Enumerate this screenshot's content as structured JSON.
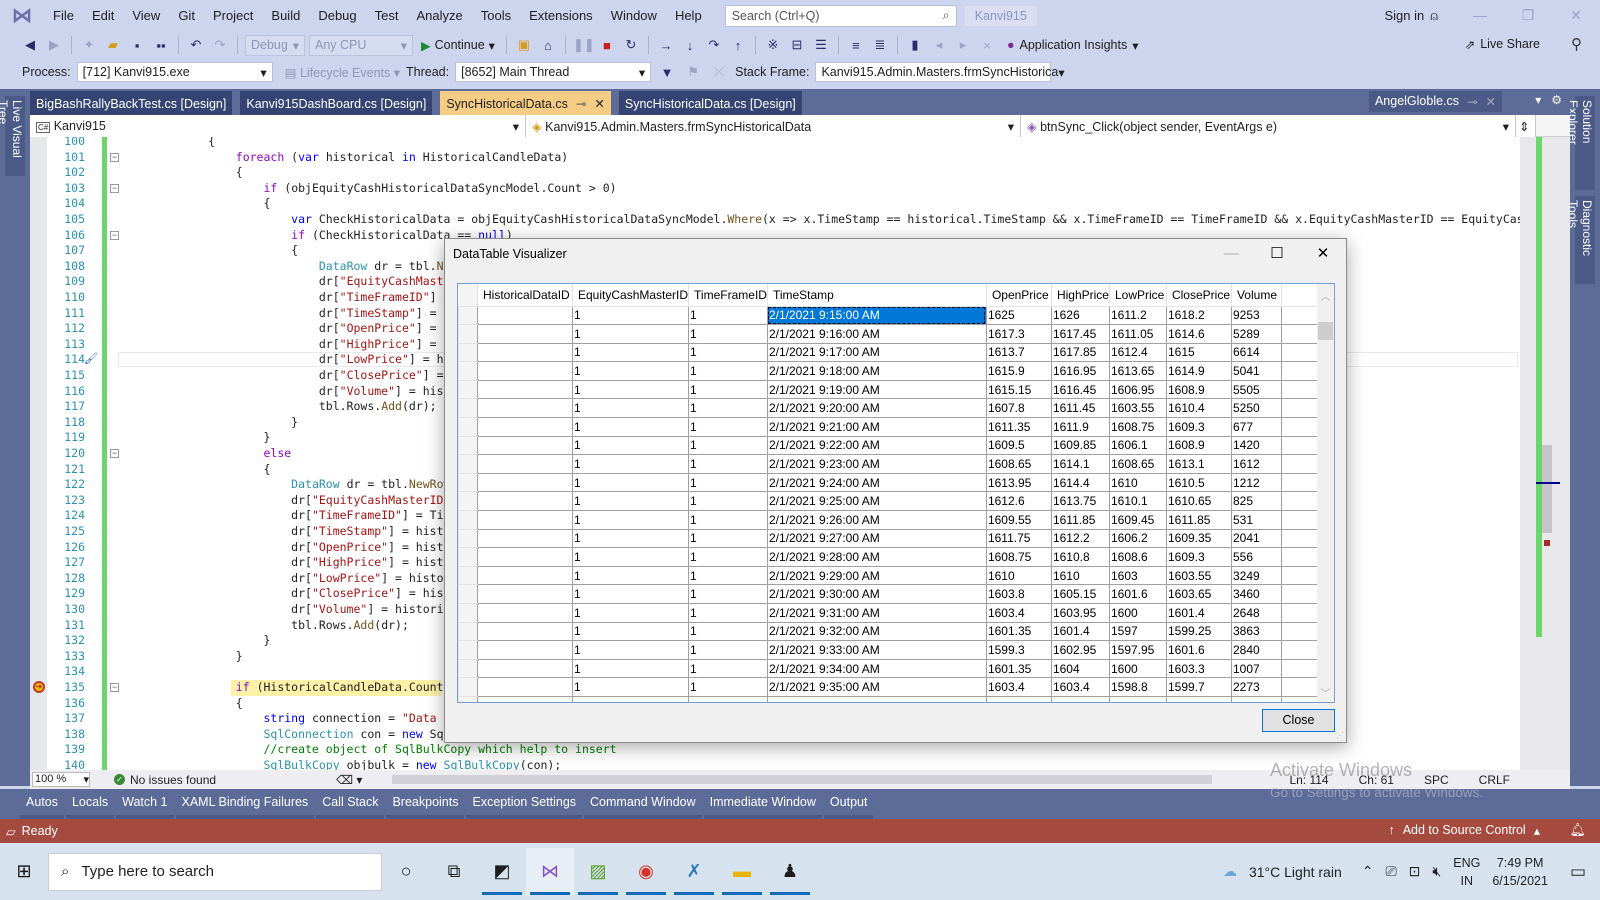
{
  "menubar": {
    "items": [
      "File",
      "Edit",
      "View",
      "Git",
      "Project",
      "Build",
      "Debug",
      "Test",
      "Analyze",
      "Tools",
      "Extensions",
      "Window",
      "Help"
    ],
    "search_placeholder": "Search (Ctrl+Q)",
    "solution_name": "Kanvi915",
    "sign_in": "Sign in"
  },
  "toolbar": {
    "config": "Debug",
    "platform": "Any CPU",
    "continue_label": "Continue",
    "app_insights": "Application Insights",
    "live_share": "Live Share"
  },
  "debugbar": {
    "process_label": "Process:",
    "process_value": "[712] Kanvi915.exe",
    "lifecycle_label": "Lifecycle Events",
    "thread_label": "Thread:",
    "thread_value": "[8652] Main Thread",
    "stack_frame_label": "Stack Frame:",
    "stack_frame_value": "Kanvi915.Admin.Masters.frmSyncHistorica"
  },
  "side_tabs": {
    "left": "Live Visual Tree",
    "right": [
      "Solution Explorer",
      "Diagnostic Tools"
    ]
  },
  "doc_tabs": [
    {
      "label": "BigBashRallyBackTest.cs [Design]",
      "active": false
    },
    {
      "label": "Kanvi915DashBoard.cs [Design]",
      "active": false
    },
    {
      "label": "SyncHistoricalData.cs",
      "active": true
    },
    {
      "label": "SyncHistoricalData.cs [Design]",
      "active": false
    }
  ],
  "preview_tab": "AngelGloble.cs",
  "navbar": {
    "project": "Kanvi915",
    "class": "Kanvi915.Admin.Masters.frmSyncHistoricalData",
    "member": "btnSync_Click(object sender, EventArgs e)"
  },
  "code_lines": [
    {
      "n": "100",
      "t": "            {"
    },
    {
      "n": "101",
      "t": "                foreach (var historical in HistoricalCandleData)"
    },
    {
      "n": "102",
      "t": "                {"
    },
    {
      "n": "103",
      "t": "                    if (objEquityCashHistoricalDataSyncModel.Count > 0)"
    },
    {
      "n": "104",
      "t": "                    {"
    },
    {
      "n": "105",
      "t": "                        var CheckHistoricalData = objEquityCashHistoricalDataSyncModel.Where(x => x.TimeStamp == historical.TimeStamp && x.TimeFrameID == TimeFrameID && x.EquityCashMasterID == EquityCashM"
    },
    {
      "n": "106",
      "t": "                        if (CheckHistoricalData == null)"
    },
    {
      "n": "107",
      "t": "                        {"
    },
    {
      "n": "108",
      "t": "                            DataRow dr = tbl.NewRow();"
    },
    {
      "n": "109",
      "t": "                            dr[\"EquityCashMasterID\"] ="
    },
    {
      "n": "110",
      "t": "                            dr[\"TimeFrameID\"] ="
    },
    {
      "n": "111",
      "t": "                            dr[\"TimeStamp\"] = h"
    },
    {
      "n": "112",
      "t": "                            dr[\"OpenPrice\"] = h"
    },
    {
      "n": "113",
      "t": "                            dr[\"HighPrice\"] = h"
    },
    {
      "n": "114",
      "t": "                            dr[\"LowPrice\"] = hi"
    },
    {
      "n": "115",
      "t": "                            dr[\"ClosePrice\"] ="
    },
    {
      "n": "116",
      "t": "                            dr[\"Volume\"] = hist"
    },
    {
      "n": "117",
      "t": "                            tbl.Rows.Add(dr);"
    },
    {
      "n": "118",
      "t": "                        }"
    },
    {
      "n": "119",
      "t": "                    }"
    },
    {
      "n": "120",
      "t": "                    else"
    },
    {
      "n": "121",
      "t": "                    {"
    },
    {
      "n": "122",
      "t": "                        DataRow dr = tbl.NewRow"
    },
    {
      "n": "123",
      "t": "                        dr[\"EquityCashMasterID\""
    },
    {
      "n": "124",
      "t": "                        dr[\"TimeFrameID\"] = Tim"
    },
    {
      "n": "125",
      "t": "                        dr[\"TimeStamp\"] = histo"
    },
    {
      "n": "126",
      "t": "                        dr[\"OpenPrice\"] = histo"
    },
    {
      "n": "127",
      "t": "                        dr[\"HighPrice\"] = histo"
    },
    {
      "n": "128",
      "t": "                        dr[\"LowPrice\"] = histor"
    },
    {
      "n": "129",
      "t": "                        dr[\"ClosePrice\"] = hist"
    },
    {
      "n": "130",
      "t": "                        dr[\"Volume\"] = historic"
    },
    {
      "n": "131",
      "t": "                        tbl.Rows.Add(dr);"
    },
    {
      "n": "132",
      "t": "                    }"
    },
    {
      "n": "133",
      "t": "                }"
    },
    {
      "n": "134",
      "t": ""
    },
    {
      "n": "135",
      "t": "                if (HistoricalCandleData.Count"
    },
    {
      "n": "136",
      "t": "                {"
    },
    {
      "n": "137",
      "t": "                    string connection = \"Data S"
    },
    {
      "n": "138",
      "t": "                    SqlConnection con = new Sql"
    },
    {
      "n": "139",
      "t": "                    //create object of SqlBulkCopy which help to insert"
    },
    {
      "n": "140",
      "t": "                    SqlBulkCopy objbulk = new SqlBulkCopy(con);"
    }
  ],
  "editor_status": {
    "zoom": "100 %",
    "issues": "No issues found",
    "line": "Ln: 114",
    "char": "Ch: 61",
    "spacing": "SPC",
    "eol": "CRLF"
  },
  "tool_tabs": [
    "Autos",
    "Locals",
    "Watch 1",
    "XAML Binding Failures",
    "Call Stack",
    "Breakpoints",
    "Exception Settings",
    "Command Window",
    "Immediate Window",
    "Output"
  ],
  "watermark": {
    "title": "Activate Windows",
    "subtitle": "Go to Settings to activate Windows."
  },
  "statusbar": {
    "ready": "Ready",
    "source_control": "Add to Source Control"
  },
  "taskbar": {
    "search_placeholder": "Type here to search",
    "weather": "31°C  Light rain",
    "lang_top": "ENG",
    "lang_bottom": "IN",
    "time": "7:49 PM",
    "date": "6/15/2021"
  },
  "dialog": {
    "title": "DataTable Visualizer",
    "close_label": "Close",
    "columns": [
      "HistoricalDataID",
      "EquityCashMasterID",
      "TimeFrameID",
      "TimeStamp",
      "OpenPrice",
      "HighPrice",
      "LowPrice",
      "ClosePrice",
      "Volume"
    ],
    "rows": [
      [
        "",
        "1",
        "1",
        "2/1/2021 9:15:00 AM",
        "1625",
        "1626",
        "1611.2",
        "1618.2",
        "9253"
      ],
      [
        "",
        "1",
        "1",
        "2/1/2021 9:16:00 AM",
        "1617.3",
        "1617.45",
        "1611.05",
        "1614.6",
        "5289"
      ],
      [
        "",
        "1",
        "1",
        "2/1/2021 9:17:00 AM",
        "1613.7",
        "1617.85",
        "1612.4",
        "1615",
        "6614"
      ],
      [
        "",
        "1",
        "1",
        "2/1/2021 9:18:00 AM",
        "1615.9",
        "1616.95",
        "1613.65",
        "1614.9",
        "5041"
      ],
      [
        "",
        "1",
        "1",
        "2/1/2021 9:19:00 AM",
        "1615.15",
        "1616.45",
        "1606.95",
        "1608.9",
        "5505"
      ],
      [
        "",
        "1",
        "1",
        "2/1/2021 9:20:00 AM",
        "1607.8",
        "1611.45",
        "1603.55",
        "1610.4",
        "5250"
      ],
      [
        "",
        "1",
        "1",
        "2/1/2021 9:21:00 AM",
        "1611.35",
        "1611.9",
        "1608.75",
        "1609.3",
        "677"
      ],
      [
        "",
        "1",
        "1",
        "2/1/2021 9:22:00 AM",
        "1609.5",
        "1609.85",
        "1606.1",
        "1608.9",
        "1420"
      ],
      [
        "",
        "1",
        "1",
        "2/1/2021 9:23:00 AM",
        "1608.65",
        "1614.1",
        "1608.65",
        "1613.1",
        "1612"
      ],
      [
        "",
        "1",
        "1",
        "2/1/2021 9:24:00 AM",
        "1613.95",
        "1614.4",
        "1610",
        "1610.5",
        "1212"
      ],
      [
        "",
        "1",
        "1",
        "2/1/2021 9:25:00 AM",
        "1612.6",
        "1613.75",
        "1610.1",
        "1610.65",
        "825"
      ],
      [
        "",
        "1",
        "1",
        "2/1/2021 9:26:00 AM",
        "1609.55",
        "1611.85",
        "1609.45",
        "1611.85",
        "531"
      ],
      [
        "",
        "1",
        "1",
        "2/1/2021 9:27:00 AM",
        "1611.75",
        "1612.2",
        "1606.2",
        "1609.35",
        "2041"
      ],
      [
        "",
        "1",
        "1",
        "2/1/2021 9:28:00 AM",
        "1608.75",
        "1610.8",
        "1608.6",
        "1609.3",
        "556"
      ],
      [
        "",
        "1",
        "1",
        "2/1/2021 9:29:00 AM",
        "1610",
        "1610",
        "1603",
        "1603.55",
        "3249"
      ],
      [
        "",
        "1",
        "1",
        "2/1/2021 9:30:00 AM",
        "1603.8",
        "1605.15",
        "1601.6",
        "1603.65",
        "3460"
      ],
      [
        "",
        "1",
        "1",
        "2/1/2021 9:31:00 AM",
        "1603.4",
        "1603.95",
        "1600",
        "1601.4",
        "2648"
      ],
      [
        "",
        "1",
        "1",
        "2/1/2021 9:32:00 AM",
        "1601.35",
        "1601.4",
        "1597",
        "1599.25",
        "3863"
      ],
      [
        "",
        "1",
        "1",
        "2/1/2021 9:33:00 AM",
        "1599.3",
        "1602.95",
        "1597.95",
        "1601.6",
        "2840"
      ],
      [
        "",
        "1",
        "1",
        "2/1/2021 9:34:00 AM",
        "1601.35",
        "1604",
        "1600",
        "1603.3",
        "1007"
      ],
      [
        "",
        "1",
        "1",
        "2/1/2021 9:35:00 AM",
        "1603.4",
        "1603.4",
        "1598.8",
        "1599.7",
        "2273"
      ]
    ],
    "selected_cell": {
      "row": 0,
      "column": "TimeStamp"
    }
  },
  "colors": {
    "status_bar": "#a54a3f",
    "active_tab": "#f5cc84",
    "frame": "#5d6b99",
    "selection": "#0078d7"
  }
}
